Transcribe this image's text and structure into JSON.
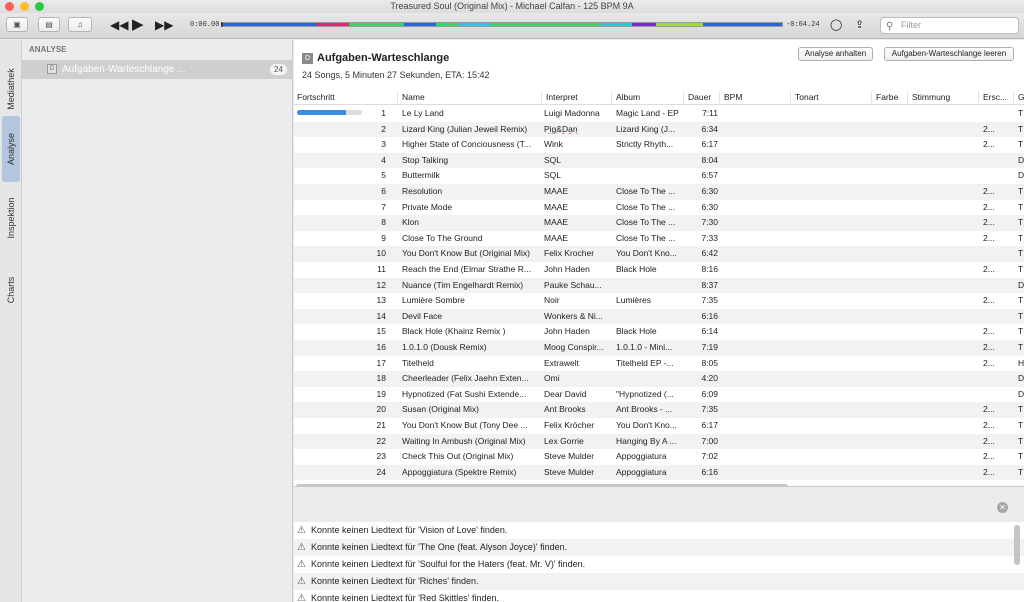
{
  "window": {
    "title": "Treasured Soul (Original Mix) - Michael Calfan - 125 BPM 9A"
  },
  "player": {
    "time_elapsed": "0:00.00",
    "time_remaining": "-0:04.24",
    "search_placeholder": "Filter",
    "waveform_colors": [
      {
        "color": "#2a66d8",
        "w": 12
      },
      {
        "color": "#e0287a",
        "w": 4
      },
      {
        "color": "#2ed86a",
        "w": 7
      },
      {
        "color": "#2a66d8",
        "w": 4
      },
      {
        "color": "#2ed86a",
        "w": 3
      },
      {
        "color": "#3ac0e6",
        "w": 4
      },
      {
        "color": "#2ed86a",
        "w": 14
      },
      {
        "color": "#26c8d2",
        "w": 4
      },
      {
        "color": "#7a2bd0",
        "w": 3
      },
      {
        "color": "#a0dc2a",
        "w": 6
      },
      {
        "color": "#2a66d8",
        "w": 10
      }
    ]
  },
  "sidebar_tabs": [
    "Mediathek",
    "Analyse",
    "Inspektion",
    "Charts"
  ],
  "left_panel": {
    "section": "ANALYSE",
    "item_label": "Aufgaben-Warteschlange ...",
    "item_count": "24"
  },
  "queue": {
    "title": "Aufgaben-Warteschlange",
    "summary": "24 Songs, 5 Minuten 27 Sekunden, ETA: 15:42",
    "btn_pause": "Analyse anhalten",
    "btn_clear": "Aufgaben-Warteschlange leeren",
    "progress_first_row": 0.75
  },
  "table": {
    "columns": [
      "Fortschritt",
      "Name",
      "Interpret",
      "Album",
      "Dauer",
      "BPM",
      "Tonart",
      "Farbe",
      "Stimmung",
      "Ersc...",
      "G"
    ],
    "rows": [
      [
        "1",
        "Le Ly Land",
        "Luigi Madonna",
        "Magic Land - EP",
        "7:11",
        "",
        "T"
      ],
      [
        "2",
        "Lizard King (Julian Jeweil Remix)",
        "Pig&Dan",
        "Lizard King (J...",
        "6:34",
        "2...",
        "T"
      ],
      [
        "3",
        "Higher State of Conciousness (T...",
        "Wink",
        "Strictly Rhyth...",
        "6:17",
        "2...",
        "T"
      ],
      [
        "4",
        "Stop Talking",
        "SQL",
        "",
        "8:04",
        "",
        "D"
      ],
      [
        "5",
        "Buttermilk",
        "SQL",
        "",
        "6:57",
        "",
        "D"
      ],
      [
        "6",
        "Resolution",
        "MAAE",
        "Close To The ...",
        "6:30",
        "2...",
        "T"
      ],
      [
        "7",
        "Private Mode",
        "MAAE",
        "Close To The ...",
        "6:30",
        "2...",
        "T"
      ],
      [
        "8",
        "Klon",
        "MAAE",
        "Close To The ...",
        "7:30",
        "2...",
        "T"
      ],
      [
        "9",
        "Close To The Ground",
        "MAAE",
        "Close To The ...",
        "7:33",
        "2...",
        "T"
      ],
      [
        "10",
        "You Don't Know But (Original Mix)",
        "Felix Krocher",
        "You Don't Kno...",
        "6:42",
        "",
        "T"
      ],
      [
        "11",
        "Reach the End (Elmar Strathe R...",
        "John Haden",
        "Black Hole",
        "8:16",
        "2...",
        "T"
      ],
      [
        "12",
        "Nuance (Tim Engelhardt Remix)",
        "Pauke Schau...",
        "",
        "8:37",
        "",
        "D"
      ],
      [
        "13",
        "Lumière Sombre",
        "Noir",
        "Lumières",
        "7:35",
        "2...",
        "T"
      ],
      [
        "14",
        "Devil Face",
        "Wonkers & Ni...",
        "",
        "6:16",
        "",
        "T"
      ],
      [
        "15",
        "Black Hole (Khainz Remix )",
        "John Haden",
        "Black Hole",
        "6:14",
        "2...",
        "T"
      ],
      [
        "16",
        "1.0.1.0 (Dousk Remix)",
        "Moog Conspir...",
        "1.0.1.0 - Mini...",
        "7:19",
        "2...",
        "T"
      ],
      [
        "17",
        "Titelheld",
        "Extrawelt",
        "Titelheld EP -...",
        "8:05",
        "2...",
        "H"
      ],
      [
        "18",
        "Cheerleader (Felix Jaehn Exten...",
        "Omi",
        "",
        "4:20",
        "",
        "D"
      ],
      [
        "19",
        "Hypnotized (Fat Sushi Extende...",
        "Dear David",
        "\"Hypnotized (...",
        "6:09",
        "",
        "D"
      ],
      [
        "20",
        "Susan (Original Mix)",
        "Ant Brooks",
        "Ant Brooks - ...",
        "7:35",
        "2...",
        "T"
      ],
      [
        "21",
        "You Don't Know But (Tony Dee ...",
        "Felix Kröcher",
        "You Don't Kno...",
        "6:17",
        "2...",
        "T"
      ],
      [
        "22",
        "Waiting In Ambush (Original Mix)",
        "Lex Gorrie",
        "Hanging By A ...",
        "7:00",
        "2...",
        "T"
      ],
      [
        "23",
        "Check This Out (Original Mix)",
        "Steve Mulder",
        "Appoggiatura",
        "7:02",
        "2...",
        "T"
      ],
      [
        "24",
        "Appoggiatura (Spektre Remix)",
        "Steve Mulder",
        "Appoggiatura",
        "6:16",
        "2...",
        "T"
      ]
    ]
  },
  "log": {
    "messages": [
      "Konnte keinen Liedtext für 'Vision of Love' finden.",
      "Konnte keinen Liedtext für 'The One (feat. Alyson Joyce)' finden.",
      "Konnte keinen Liedtext für 'Soulful for the Haters (feat. Mr. V)' finden.",
      "Konnte keinen Liedtext für 'Riches' finden.",
      "Konnte keinen Liedtext für 'Red Skittles' finden."
    ]
  }
}
